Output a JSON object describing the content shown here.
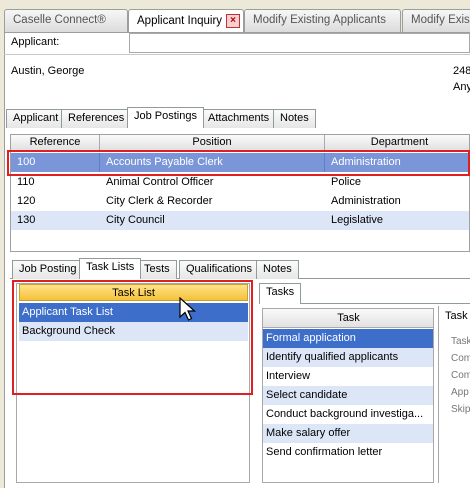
{
  "doc_tabs": [
    {
      "label": "Caselle Connect®"
    },
    {
      "label": "Applicant Inquiry"
    },
    {
      "label": "Modify Existing Applicants"
    },
    {
      "label": "Modify Exis"
    }
  ],
  "applicant": {
    "label": "Applicant:",
    "value": "",
    "name": "Austin, George",
    "right_top": "248",
    "right_bottom": "Any"
  },
  "main_tabs": [
    {
      "label": "Applicant"
    },
    {
      "label": "References"
    },
    {
      "label": "Job Postings"
    },
    {
      "label": "Attachments"
    },
    {
      "label": "Notes"
    }
  ],
  "postings": {
    "columns": [
      "Reference",
      "Position",
      "Department"
    ],
    "rows": [
      {
        "reference": "100",
        "position": "Accounts Payable Clerk",
        "department": "Administration"
      },
      {
        "reference": "110",
        "position": "Animal Control Officer",
        "department": "Police"
      },
      {
        "reference": "120",
        "position": "City Clerk & Recorder",
        "department": "Administration"
      },
      {
        "reference": "130",
        "position": "City Council",
        "department": "Legislative"
      }
    ]
  },
  "sub_tabs": [
    {
      "label": "Job Posting"
    },
    {
      "label": "Task Lists"
    },
    {
      "label": "Tests"
    },
    {
      "label": "Qualifications"
    },
    {
      "label": "Notes"
    }
  ],
  "task_list": {
    "header": "Task List",
    "items": [
      {
        "label": "Applicant Task List"
      },
      {
        "label": "Background Check"
      }
    ]
  },
  "tasks_tab": {
    "label": "Tasks"
  },
  "tasks": {
    "header": "Task",
    "items": [
      {
        "label": "Formal application"
      },
      {
        "label": "Identify qualified applicants"
      },
      {
        "label": "Interview"
      },
      {
        "label": "Select candidate"
      },
      {
        "label": "Conduct background investiga..."
      },
      {
        "label": "Make salary offer"
      },
      {
        "label": "Send confirmation letter"
      }
    ]
  },
  "detail": {
    "header": "Task",
    "labels": [
      "Task",
      "Com",
      "Com",
      "App",
      "Skip"
    ]
  },
  "colors": {
    "selection": "#3d6ec9",
    "grid_selection": "#7a96d8",
    "alt_row": "#dce6f7",
    "highlight_box": "#e02020",
    "task_header": "#f5c238"
  }
}
